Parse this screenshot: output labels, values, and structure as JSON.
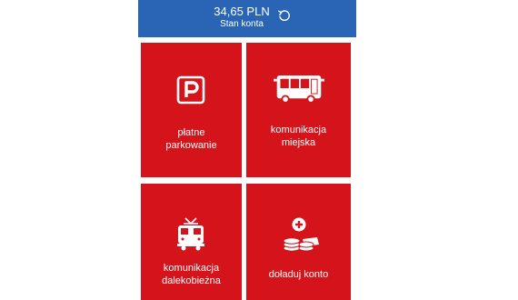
{
  "header": {
    "balance": "34,65 PLN",
    "balance_label": "Stan konta",
    "background": "#2a64b4"
  },
  "tiles": [
    {
      "line1": "płatne",
      "line2": "parkowanie",
      "icon": "parking-icon"
    },
    {
      "line1": "komunikacja",
      "line2": "miejska",
      "icon": "bus-icon"
    },
    {
      "line1": "komunikacja",
      "line2": "dalekobieżna",
      "icon": "train-icon"
    },
    {
      "line1": "doładuj konto",
      "line2": "",
      "icon": "coins-add-icon"
    }
  ],
  "colors": {
    "tile": "#d4131b",
    "text": "#ffffff"
  }
}
